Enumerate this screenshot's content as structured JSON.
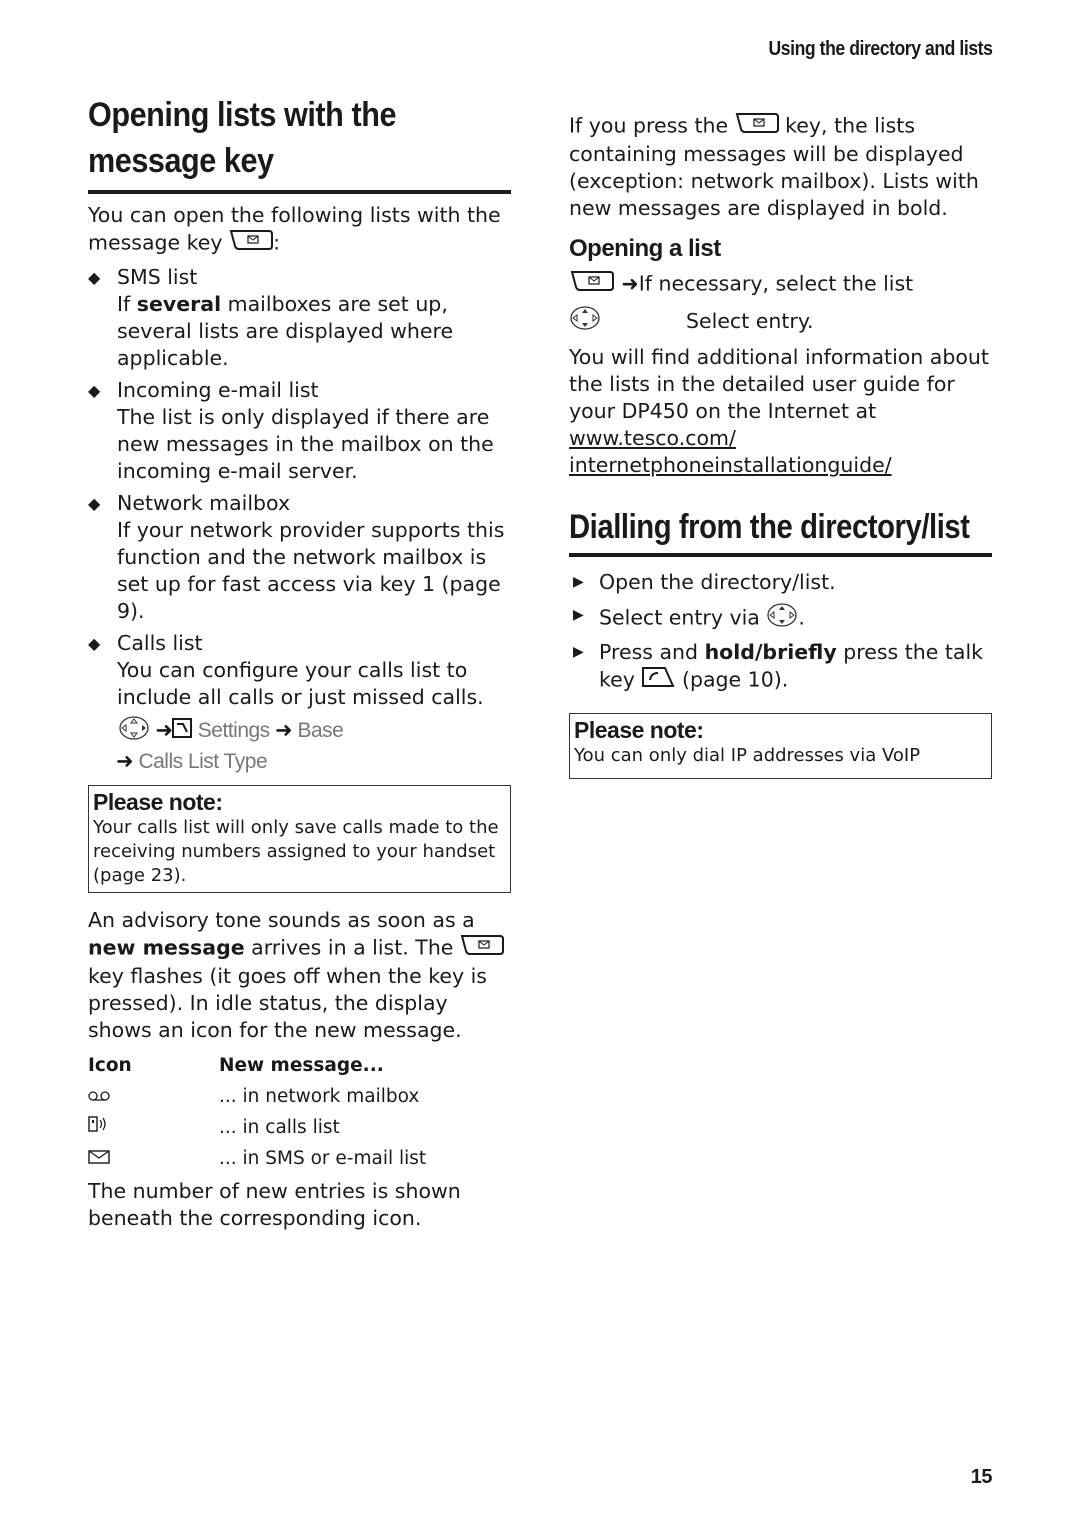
{
  "running_head": "Using the directory and lists",
  "page_number": "15",
  "left": {
    "heading_line1": "Opening lists with the",
    "heading_line2": "message key",
    "intro_a": "You can open the following lists with the message key",
    "intro_b": ":",
    "items": [
      {
        "title": "SMS list",
        "desc_pre": "If ",
        "desc_bold": "several",
        "desc_post": " mailboxes are set up, several lists are displayed where applicable."
      },
      {
        "title": "Incoming e-mail list",
        "desc": "The list is only displayed if there are new messages in the mailbox on the incoming e-mail server."
      },
      {
        "title": "Network mailbox",
        "desc": "If your network provider supports this function and the network mailbox is set up for fast access via key 1 (page 9)."
      },
      {
        "title": "Calls list",
        "desc": "You can configure your calls list to include all calls or just missed calls."
      }
    ],
    "menu_path": {
      "step1": "Settings",
      "step2": "Base",
      "step3": "Calls List Type"
    },
    "note": {
      "title": "Please note:",
      "text": "Your calls list will only save calls made to the receiving numbers assigned to your handset (page 23)."
    },
    "advisory_a": "An advisory tone sounds as soon as a ",
    "advisory_bold": "new message",
    "advisory_b": " arrives in a list. The ",
    "advisory_c": " key flashes (it goes off when the key is pressed). In idle status, the display shows an icon for the new message.",
    "icon_table": {
      "header_icon": "Icon",
      "header_msg": "New message...",
      "rows": [
        {
          "icon": "voicemail-icon",
          "text": "... in network mailbox"
        },
        {
          "icon": "calls-list-icon",
          "text": "... in calls list"
        },
        {
          "icon": "envelope-icon",
          "text": "... in SMS or e-mail list"
        }
      ]
    },
    "footer_text": "The number of new entries is shown beneath the corresponding icon."
  },
  "right": {
    "intro_a": "If you press the",
    "intro_b": "key, the lists containing messages will be displayed (exception: network mailbox). Lists with new messages are displayed in bold.",
    "opening_heading": "Opening a list",
    "open_step1": "If necessary, select the list",
    "open_step2": "Select entry.",
    "info_text": "You will find additional information about the lists in the detailed user guide for your DP450 on the Internet at",
    "link1": "www.tesco.com/",
    "link2": "internetphoneinstallationguide/",
    "dial_heading": "Dialling from the directory/list",
    "steps": [
      {
        "text": "Open the directory/list."
      },
      {
        "text_a": "Select entry via",
        "text_b": "."
      },
      {
        "text_a": "Press and ",
        "bold": "hold/briefly",
        "text_b": " press the talk key",
        "text_c": "(page 10)."
      }
    ],
    "note": {
      "title": "Please note:",
      "text": "You can only dial IP addresses via VoIP"
    }
  }
}
